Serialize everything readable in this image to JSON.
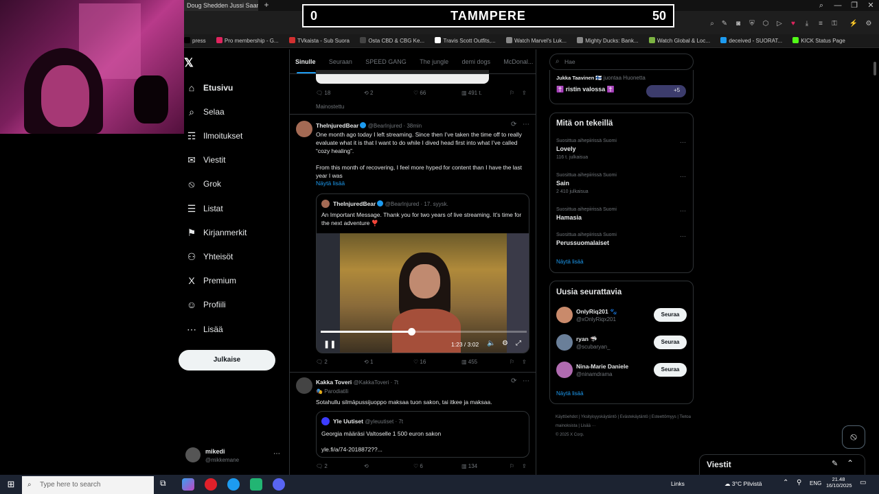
{
  "browser": {
    "active_tab": "Doug Shedden Jussi Saari...",
    "new_tab": "+",
    "window_buttons": [
      "⌕",
      "—",
      "❐",
      "✕"
    ],
    "bookmarks": [
      {
        "label": "press",
        "color": "#000000"
      },
      {
        "label": "Pro membership - G...",
        "color": "#e0245e"
      },
      {
        "label": "TVkaista - Sub Suora",
        "color": "#d23030"
      },
      {
        "label": "Osta CBD & CBG Ke...",
        "color": "#444444"
      },
      {
        "label": "Travis Scott Outfits,...",
        "color": "#ffffff"
      },
      {
        "label": "Watch Marvel's Luk...",
        "color": "#888888"
      },
      {
        "label": "Mighty Ducks: Bank...",
        "color": "#888888"
      },
      {
        "label": "Watch Global & Loc...",
        "color": "#7cb342"
      },
      {
        "label": "deceived - SUORAT...",
        "color": "#1d9bf0"
      },
      {
        "label": "KICK Status Page",
        "color": "#53fc18"
      }
    ]
  },
  "scoreboard": {
    "left": "0",
    "title": "TAMMPERE",
    "right": "50"
  },
  "nav": {
    "items": [
      {
        "icon": "⌂",
        "label": "Etusivu",
        "name": "home"
      },
      {
        "icon": "⌕",
        "label": "Selaa",
        "name": "explore"
      },
      {
        "icon": "☶",
        "label": "Ilmoitukset",
        "name": "notifications"
      },
      {
        "icon": "✉",
        "label": "Viestit",
        "name": "messages"
      },
      {
        "icon": "⦸",
        "label": "Grok",
        "name": "grok"
      },
      {
        "icon": "☰",
        "label": "Listat",
        "name": "lists"
      },
      {
        "icon": "⚑",
        "label": "Kirjanmerkit",
        "name": "bookmarks"
      },
      {
        "icon": "⚇",
        "label": "Yhteisöt",
        "name": "communities"
      },
      {
        "icon": "X",
        "label": "Premium",
        "name": "premium"
      },
      {
        "icon": "☺",
        "label": "Profiili",
        "name": "profile"
      },
      {
        "icon": "⋯",
        "label": "Lisää",
        "name": "more"
      }
    ],
    "post_button": "Julkaise",
    "account": {
      "name": "mikedi",
      "handle": "@mikkemane",
      "more": "⋯"
    }
  },
  "timeline": {
    "tabs": [
      "Sinulle",
      "Seuraan",
      "SPEED GANG",
      "The jungle",
      "demi dogs",
      "McDonal..."
    ],
    "ad": {
      "replies": "18",
      "reposts": "2",
      "likes": "66",
      "views": "491 t.",
      "label": "Mainostettu"
    },
    "post1": {
      "name": "TheInjuredBear",
      "handle": "@BearInjured · 38min",
      "text1": "One month ago today I left streaming. Since then I’ve taken the time off to really evaluate what it is that I want to do while I dived head first into what I’ve called “cozy healing”.",
      "text2": "From this month of recovering, I feel more hyped for content than I have the last year I was",
      "show_more": "Näytä lisää",
      "quote": {
        "name": "TheInjuredBear",
        "handle": "@BearInjured · 17. syysk.",
        "text": "An Important Message. Thank you for two years of live streaming. It’s time for the next adventure ❣️",
        "video": {
          "time": "1:23 / 3:02",
          "progress": 0.44
        }
      },
      "replies": "2",
      "reposts": "1",
      "likes": "16",
      "views": "455"
    },
    "post2": {
      "name": "Kakka Toveri",
      "handle": "@KakkaToveri · 7t",
      "badge": "Parodiatili",
      "text": "Sotahullu silmäpussijuoppo maksaa tuon sakon, tai itkee ja maksaa.",
      "quote": {
        "name": "Yle Uutiset",
        "handle": "@yleuutiset · 7t",
        "text": "Georgia määräsi Valtoselle 1 500 euron sakon",
        "link": "yle.fi/a/74-2018872??..."
      },
      "replies": "2",
      "likes": "6",
      "views": "134"
    }
  },
  "right": {
    "search_placeholder": "Hae",
    "space": {
      "host": "Jukka Taavinen 🇫🇮",
      "host_suffix": "juontaa Huonetta",
      "title": "✝️ ristin valossa ✝️",
      "extra": "+5"
    },
    "trends_title": "Mitä on tekeillä",
    "trends": [
      {
        "context": "Suosittua aihepiirissä Suomi",
        "name": "Lovely",
        "count": "116 t. julkaisua"
      },
      {
        "context": "Suosittua aihepiirissä Suomi",
        "name": "Sain",
        "count": "2 410 julkaisua"
      },
      {
        "context": "Suosittua aihepiirissä Suomi",
        "name": "Hamasia",
        "count": ""
      },
      {
        "context": "Suosittua aihepiirissä Suomi",
        "name": "Perussuomalaiset",
        "count": ""
      }
    ],
    "show_more": "Näytä lisää",
    "follow_title": "Uusia seurattavia",
    "follows": [
      {
        "name": "OnlyRiq201 🐾",
        "handle": "@xOnlyRiqx201",
        "btn": "Seuraa",
        "color": "#c98a6b"
      },
      {
        "name": "ryan 🦈",
        "handle": "@scubaryan_",
        "btn": "Seuraa",
        "color": "#6a7f99"
      },
      {
        "name": "Nina-Marie Daniele",
        "handle": "@ninamdrama",
        "btn": "Seuraa",
        "color": "#b06bb0"
      }
    ],
    "follow_more": "Näytä lisää",
    "footer": [
      "Käyttöehdot",
      "Yksityisyyskäytäntö",
      "Evästekäytäntö",
      "Esteettömyys",
      "Tietoa mainoksista",
      "Lisää ···",
      "© 2025 X Corp."
    ]
  },
  "drawer": {
    "title": "Viestit"
  },
  "taskbar": {
    "search_placeholder": "Type here to search",
    "links": "Links",
    "weather": "3°C  Pilvistä",
    "lang": "ENG",
    "time": "21.48",
    "date": "16/10/2025"
  }
}
